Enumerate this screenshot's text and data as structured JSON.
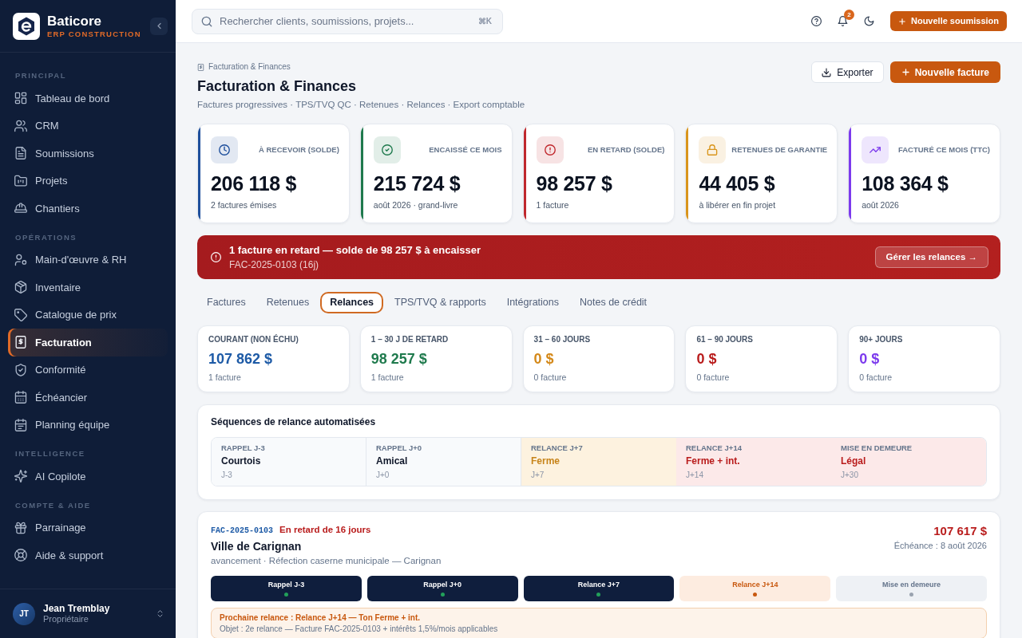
{
  "sidebar": {
    "brand": {
      "name": "Baticore",
      "tagline": "ERP CONSTRUCTION"
    },
    "sections": [
      {
        "title": "PRINCIPAL",
        "items": [
          {
            "label": "Tableau de bord",
            "selected": false
          },
          {
            "label": "CRM",
            "selected": false
          },
          {
            "label": "Soumissions",
            "selected": false
          },
          {
            "label": "Projets",
            "selected": false
          },
          {
            "label": "Chantiers",
            "selected": false
          }
        ]
      },
      {
        "title": "OPÉRATIONS",
        "items": [
          {
            "label": "Main-d'œuvre & RH",
            "selected": false
          },
          {
            "label": "Inventaire",
            "selected": false
          },
          {
            "label": "Catalogue de prix",
            "selected": false
          },
          {
            "label": "Facturation",
            "selected": true
          },
          {
            "label": "Conformité",
            "selected": false
          },
          {
            "label": "Échéancier",
            "selected": false
          },
          {
            "label": "Planning équipe",
            "selected": false
          }
        ]
      },
      {
        "title": "INTELLIGENCE",
        "items": [
          {
            "label": "AI Copilote",
            "selected": false
          }
        ]
      },
      {
        "title": "COMPTE & AIDE",
        "items": [
          {
            "label": "Parrainage",
            "selected": false
          },
          {
            "label": "Aide & support",
            "selected": false
          }
        ]
      }
    ],
    "user": {
      "initials": "JT",
      "name": "Jean Tremblay",
      "role": "Propriétaire"
    }
  },
  "topbar": {
    "search": {
      "placeholder": "Rechercher clients, soumissions, projets...",
      "shortcut": "⌘K"
    },
    "notification_count": "2",
    "button": "Nouvelle soumission"
  },
  "page": {
    "breadcrumb": "Facturation & Finances",
    "title": "Facturation & Finances",
    "subtitle": "Factures progressives · TPS/TVQ QC · Retenues · Relances · Export comptable",
    "export_button": "Exporter",
    "new_button": "Nouvelle facture"
  },
  "kpis": [
    {
      "label": "À RECEVOIR (SOLDE)",
      "value": "206 118 $",
      "note": "2 factures émises",
      "color": "#1e4f9c"
    },
    {
      "label": "ENCAISSÉ CE MOIS",
      "value": "215 724 $",
      "note": "août 2026 · grand-livre",
      "color": "#1f7a4d"
    },
    {
      "label": "EN RETARD (SOLDE)",
      "value": "98 257 $",
      "note": "1 facture",
      "color": "#c0282d"
    },
    {
      "label": "RETENUES DE GARANTIE",
      "value": "44 405 $",
      "note": "à libérer en fin projet",
      "color": "#d9951c"
    },
    {
      "label": "FACTURÉ CE MOIS (TTC)",
      "value": "108 364 $",
      "note": "août 2026",
      "color": "#7c3aed"
    }
  ],
  "alert": {
    "title": "1 facture en retard — solde de 98 257 $ à encaisser",
    "detail": "FAC-2025-0103 (16j)",
    "button": "Gérer les relances →"
  },
  "tabs": [
    {
      "label": "Factures",
      "selected": false
    },
    {
      "label": "Retenues",
      "selected": false
    },
    {
      "label": "Relances",
      "selected": true
    },
    {
      "label": "TPS/TVQ & rapports",
      "selected": false
    },
    {
      "label": "Intégrations",
      "selected": false
    },
    {
      "label": "Notes de crédit",
      "selected": false
    }
  ],
  "aging": [
    {
      "label": "COURANT (NON ÉCHU)",
      "value": "107 862 $",
      "note": "1 facture",
      "color": "#1d5aa6"
    },
    {
      "label": "1 – 30 J DE RETARD",
      "value": "98 257 $",
      "note": "1 facture",
      "color": "#1f7a4d"
    },
    {
      "label": "31 – 60 JOURS",
      "value": "0 $",
      "note": "0 facture",
      "color": "#d4891a"
    },
    {
      "label": "61 – 90 JOURS",
      "value": "0 $",
      "note": "0 facture",
      "color": "#b91c1c"
    },
    {
      "label": "90+ JOURS",
      "value": "0 $",
      "note": "0 facture",
      "color": "#7c3aed"
    }
  ],
  "sequences": {
    "title": "Séquences de relance automatisées",
    "steps": [
      {
        "label": "RAPPEL J-3",
        "title": "Courtois",
        "day": "J-3",
        "kind": "neutral"
      },
      {
        "label": "RAPPEL J+0",
        "title": "Amical",
        "day": "J+0",
        "kind": "neutral"
      },
      {
        "label": "RELANCE J+7",
        "title": "Ferme",
        "day": "J+7",
        "kind": "warning"
      },
      {
        "label": "RELANCE J+14",
        "title": "Ferme + int.",
        "day": "J+14",
        "kind": "danger"
      },
      {
        "label": "MISE EN DEMEURE",
        "title": "Légal",
        "day": "J+30",
        "kind": "danger"
      }
    ]
  },
  "invoice": {
    "number": "FAC-2025-0103",
    "status": "En retard de 16 jours",
    "client": "Ville de Carignan",
    "description": "avancement · Réfection caserne municipale — Carignan",
    "amount": "107 617 $",
    "due": "Échéance : 8 août 2026",
    "steps": [
      {
        "label": "Rappel J-3",
        "kind": "done"
      },
      {
        "label": "Rappel J+0",
        "kind": "done"
      },
      {
        "label": "Relance J+7",
        "kind": "done"
      },
      {
        "label": "Relance J+14",
        "kind": "current"
      },
      {
        "label": "Mise en demeure",
        "kind": "pending"
      }
    ],
    "next": {
      "title": "Prochaine relance : Relance J+14 — Ton Ferme + int.",
      "subject": "Objet : 2e relance — Facture FAC-2025-0103 + intérêts 1,5%/mois applicables"
    }
  }
}
